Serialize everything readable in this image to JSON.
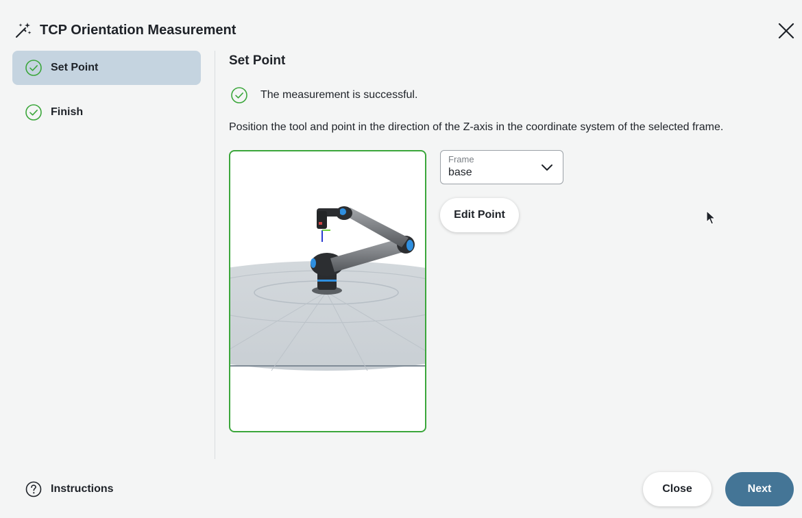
{
  "header": {
    "title": "TCP Orientation Measurement",
    "icons": {
      "wand": "magic-wand-icon",
      "close": "close-icon"
    }
  },
  "sidebar": {
    "steps": [
      {
        "label": "Set Point",
        "active": true,
        "status": "complete"
      },
      {
        "label": "Finish",
        "active": false,
        "status": "complete"
      }
    ]
  },
  "main": {
    "section_title": "Set Point",
    "success_message": "The measurement is successful.",
    "instruction": "Position the tool and point in the direction of the Z-axis in the coordinate system of the selected frame.",
    "frame": {
      "label": "Frame",
      "value": "base"
    },
    "edit_point_label": "Edit Point"
  },
  "footer": {
    "instructions_label": "Instructions",
    "close_label": "Close",
    "next_label": "Next"
  },
  "colors": {
    "background": "#f4f5f5",
    "active_step": "#c5d4e0",
    "success_green": "#3aa63a",
    "primary_button": "#447596",
    "robot_joint_accent": "#2f8fe0"
  }
}
